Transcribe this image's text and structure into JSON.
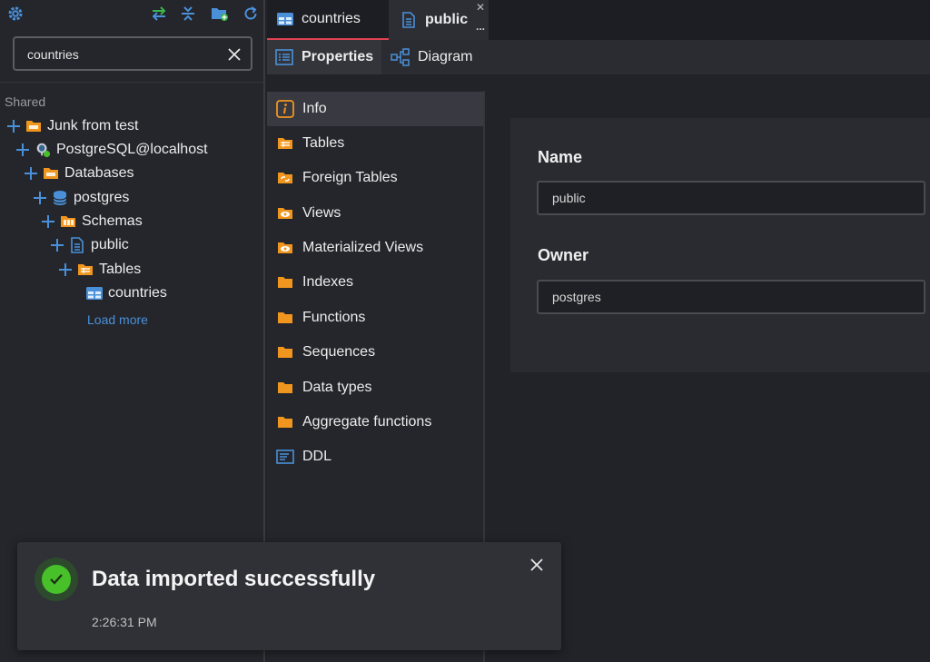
{
  "colors": {
    "accent": "#4a90d9",
    "tab_indicator": "#e0434f",
    "folder_orange": "#f0961e",
    "success_green": "#47c02a",
    "toolbar_green": "#3bb54a"
  },
  "toolbar": {
    "icons": [
      "settings-gear-icon",
      "sync-arrows-icon",
      "collapse-all-icon",
      "new-folder-icon",
      "refresh-icon"
    ]
  },
  "search": {
    "value": "countries",
    "placeholder": ""
  },
  "sidebar": {
    "section_label": "Shared",
    "tree": [
      {
        "label": "Junk from test",
        "icon": "folder-icon"
      },
      {
        "label": "PostgreSQL@localhost",
        "icon": "postgres-elephant-icon"
      },
      {
        "label": "Databases",
        "icon": "folder-icon"
      },
      {
        "label": "postgres",
        "icon": "database-icon"
      },
      {
        "label": "Schemas",
        "icon": "schemas-folder-icon"
      },
      {
        "label": "public",
        "icon": "schema-doc-icon"
      },
      {
        "label": "Tables",
        "icon": "tables-folder-icon"
      },
      {
        "label": "countries",
        "icon": "table-icon"
      }
    ],
    "load_more": "Load more"
  },
  "tabs": [
    {
      "label": "countries",
      "icon": "table-icon"
    },
    {
      "label": "public",
      "icon": "schema-doc-icon",
      "close": "✕",
      "more": "..."
    }
  ],
  "subtabs": [
    {
      "label": "Properties",
      "icon": "properties-list-icon"
    },
    {
      "label": "Diagram",
      "icon": "diagram-icon"
    }
  ],
  "categories": [
    {
      "label": "Info",
      "icon": "info-icon"
    },
    {
      "label": "Tables",
      "icon": "tables-folder-icon"
    },
    {
      "label": "Foreign Tables",
      "icon": "foreign-tables-icon"
    },
    {
      "label": "Views",
      "icon": "views-eye-icon"
    },
    {
      "label": "Materialized Views",
      "icon": "materialized-views-eye-icon"
    },
    {
      "label": "Indexes",
      "icon": "folder-icon"
    },
    {
      "label": "Functions",
      "icon": "folder-icon"
    },
    {
      "label": "Sequences",
      "icon": "folder-icon"
    },
    {
      "label": "Data types",
      "icon": "folder-icon"
    },
    {
      "label": "Aggregate functions",
      "icon": "folder-icon"
    },
    {
      "label": "DDL",
      "icon": "ddl-document-icon"
    }
  ],
  "detail": {
    "name_label": "Name",
    "name_value": "public",
    "owner_label": "Owner",
    "owner_value": "postgres"
  },
  "toast": {
    "title": "Data imported successfully",
    "time": "2:26:31 PM"
  }
}
